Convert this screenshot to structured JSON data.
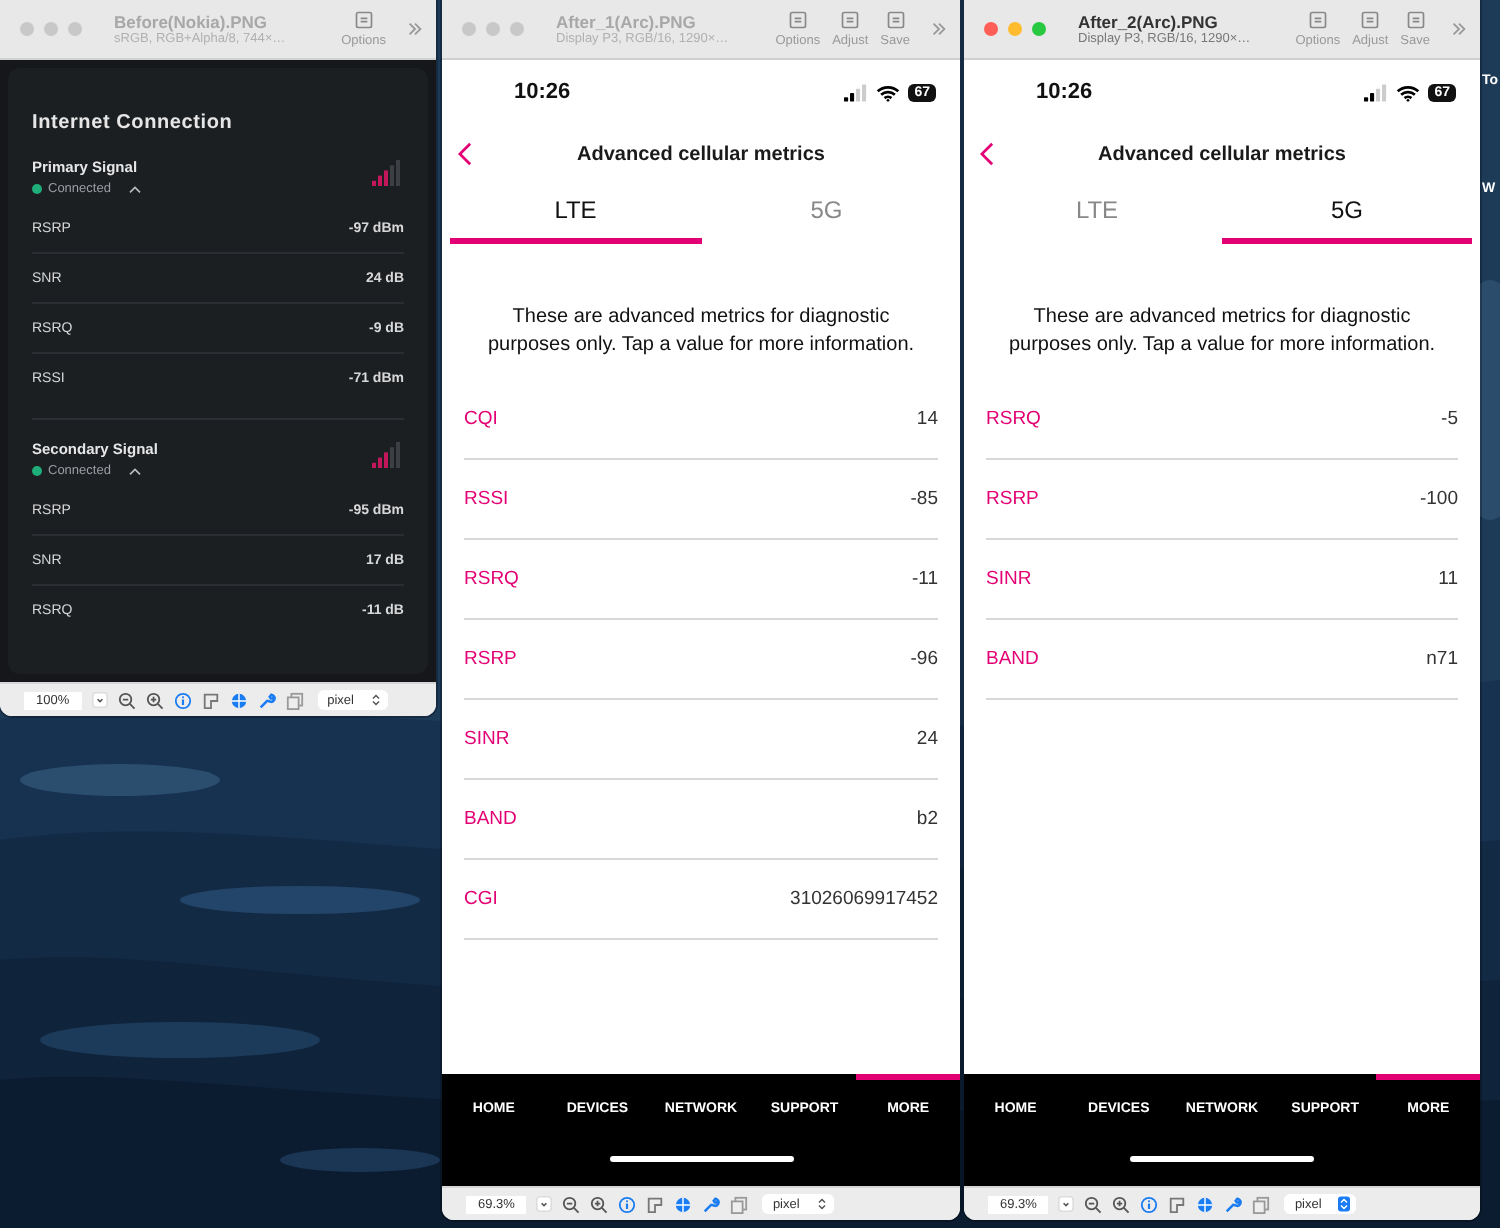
{
  "desktop": {
    "labels": [
      "To",
      "W"
    ]
  },
  "windows": [
    {
      "kind": "nokia",
      "active": false,
      "title": "Before(Nokia).PNG",
      "subtitle": "sRGB, RGB+Alpha/8, 744×…",
      "tools": [
        "Options"
      ],
      "zoom": "100%",
      "unit": "pixel",
      "content": {
        "heading": "Internet Connection",
        "signals": [
          {
            "name": "Primary Signal",
            "status": "Connected",
            "expanded": true,
            "metrics": [
              {
                "name": "RSRP",
                "value": "-97 dBm"
              },
              {
                "name": "SNR",
                "value": "24 dB"
              },
              {
                "name": "RSRQ",
                "value": "-9 dB"
              },
              {
                "name": "RSSI",
                "value": "-71 dBm"
              }
            ]
          },
          {
            "name": "Secondary Signal",
            "status": "Connected",
            "expanded": true,
            "metrics": [
              {
                "name": "RSRP",
                "value": "-95 dBm"
              },
              {
                "name": "SNR",
                "value": "17 dB"
              },
              {
                "name": "RSRQ",
                "value": "-11 dB"
              }
            ]
          }
        ]
      }
    },
    {
      "kind": "phone",
      "active": false,
      "title": "After_1(Arc).PNG",
      "subtitle": "Display P3, RGB/16, 1290×…",
      "tools": [
        "Options",
        "Adjust",
        "Save"
      ],
      "zoom": "69.3%",
      "unit": "pixel",
      "content": {
        "time": "10:26",
        "battery": "67",
        "header": "Advanced cellular metrics",
        "tabs": [
          {
            "label": "LTE",
            "selected": true
          },
          {
            "label": "5G",
            "selected": false
          }
        ],
        "description": "These are advanced metrics for diagnostic purposes only. Tap a value for more information.",
        "metrics": [
          {
            "name": "CQI",
            "value": "14"
          },
          {
            "name": "RSSI",
            "value": "-85"
          },
          {
            "name": "RSRQ",
            "value": "-11"
          },
          {
            "name": "RSRP",
            "value": "-96"
          },
          {
            "name": "SINR",
            "value": "24"
          },
          {
            "name": "BAND",
            "value": "b2"
          },
          {
            "name": "CGI",
            "value": "31026069917452"
          }
        ],
        "nav": [
          {
            "label": "HOME",
            "selected": false
          },
          {
            "label": "DEVICES",
            "selected": false
          },
          {
            "label": "NETWORK",
            "selected": false
          },
          {
            "label": "SUPPORT",
            "selected": false
          },
          {
            "label": "MORE",
            "selected": true
          }
        ]
      }
    },
    {
      "kind": "phone",
      "active": true,
      "title": "After_2(Arc).PNG",
      "subtitle": "Display P3, RGB/16, 1290×…",
      "tools": [
        "Options",
        "Adjust",
        "Save"
      ],
      "zoom": "69.3%",
      "unit": "pixel",
      "content": {
        "time": "10:26",
        "battery": "67",
        "header": "Advanced cellular metrics",
        "tabs": [
          {
            "label": "LTE",
            "selected": false
          },
          {
            "label": "5G",
            "selected": true
          }
        ],
        "description": "These are advanced metrics for diagnostic purposes only. Tap a value for more information.",
        "metrics": [
          {
            "name": "RSRQ",
            "value": "-5"
          },
          {
            "name": "RSRP",
            "value": "-100"
          },
          {
            "name": "SINR",
            "value": "11"
          },
          {
            "name": "BAND",
            "value": "n71"
          }
        ],
        "nav": [
          {
            "label": "HOME",
            "selected": false
          },
          {
            "label": "DEVICES",
            "selected": false
          },
          {
            "label": "NETWORK",
            "selected": false
          },
          {
            "label": "SUPPORT",
            "selected": false
          },
          {
            "label": "MORE",
            "selected": true
          }
        ]
      }
    }
  ]
}
